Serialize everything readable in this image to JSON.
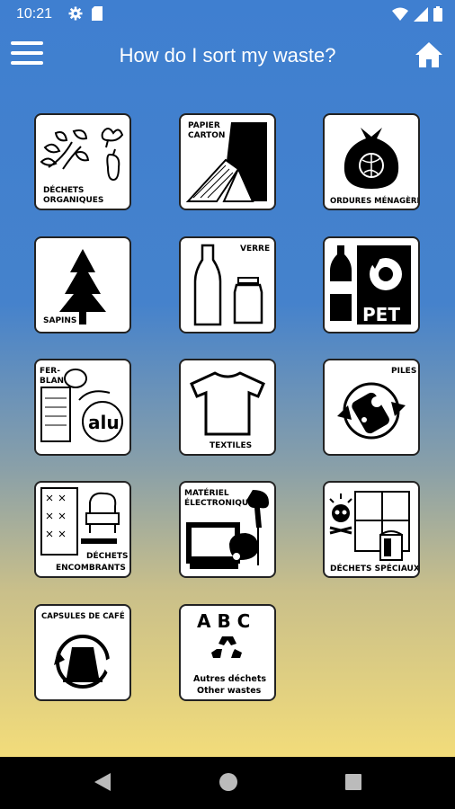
{
  "status": {
    "time": "10:21"
  },
  "app": {
    "title": "How do I sort my waste?"
  },
  "tiles": {
    "organic": {
      "line1": "DÉCHETS",
      "line2": "ORGANIQUES"
    },
    "paper": {
      "line1": "PAPIER",
      "line2": "CARTON"
    },
    "household": {
      "line1": "ORDURES MÉNAGÈRES"
    },
    "trees": {
      "line1": "SAPINS"
    },
    "glass": {
      "line1": "VERRE"
    },
    "pet": {
      "line1": "PET"
    },
    "tin": {
      "line1": "FER-",
      "line2": "BLANC",
      "badge": "alu"
    },
    "batteries": {
      "line1": "PILES"
    },
    "textiles": {
      "line1": "TEXTILES"
    },
    "bulky": {
      "line1": "DÉCHETS",
      "line2": "ENCOMBRANTS"
    },
    "electronics": {
      "line1": "MATÉRIEL",
      "line2": "ÉLECTRONIQUE"
    },
    "special": {
      "line1": "DÉCHETS SPÉCIAUX"
    },
    "coffee": {
      "line1": "CAPSULES DE CAFÉ"
    },
    "other": {
      "letters": "A B C",
      "line1": "Autres déchets",
      "line2": "Other wastes"
    }
  }
}
